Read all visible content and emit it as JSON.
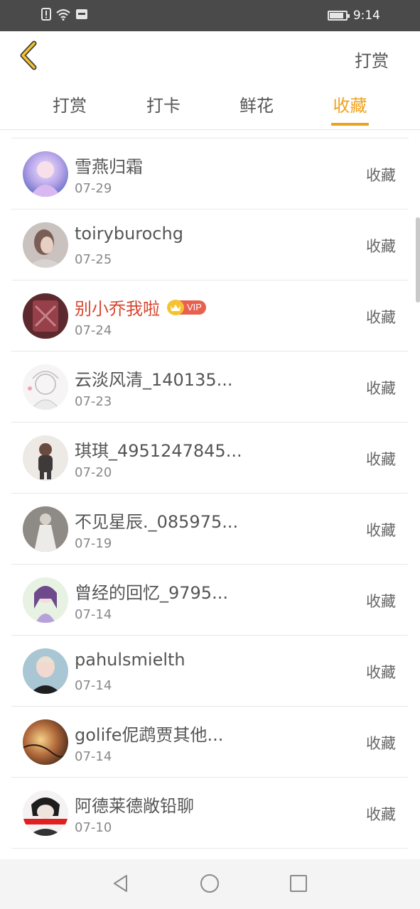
{
  "status_bar": {
    "time": "9:14",
    "icons": [
      "alert-icon",
      "wifi-icon",
      "sms-icon",
      "battery-icon"
    ]
  },
  "header": {
    "back_icon": "chevron-left-icon",
    "action_label": "打赏"
  },
  "tabs": [
    {
      "label": "打赏",
      "active": false
    },
    {
      "label": "打卡",
      "active": false
    },
    {
      "label": "鲜花",
      "active": false
    },
    {
      "label": "收藏",
      "active": true
    }
  ],
  "colors": {
    "accent": "#f0a21d",
    "vip_name": "#d8452e",
    "status_bar": "#4a4a4a"
  },
  "vip_badge_label": "VIP",
  "list": [
    {
      "name": "雪燕归霜",
      "date": "07-29",
      "action": "收藏"
    },
    {
      "name": "toiryburochg",
      "date": "07-25",
      "action": "收藏"
    },
    {
      "name": "别小乔我啦",
      "date": "07-24",
      "action": "收藏",
      "vip": true
    },
    {
      "name": "云淡风清_140135...",
      "date": "07-23",
      "action": "收藏"
    },
    {
      "name": "琪琪_4951247845...",
      "date": "07-20",
      "action": "收藏"
    },
    {
      "name": "不见星辰._085975...",
      "date": "07-19",
      "action": "收藏"
    },
    {
      "name": "曾经的回忆_9795...",
      "date": "07-14",
      "action": "收藏"
    },
    {
      "name": "pahulsmielth",
      "date": "07-14",
      "action": "收藏"
    },
    {
      "name": "golife伲鹉贾其他...",
      "date": "07-14",
      "action": "收藏"
    },
    {
      "name": "阿德莱德敞铅聊",
      "date": "07-10",
      "action": "收藏"
    }
  ],
  "nav_bar": {
    "buttons": [
      "back-triangle-icon",
      "home-circle-icon",
      "recents-square-icon"
    ]
  }
}
